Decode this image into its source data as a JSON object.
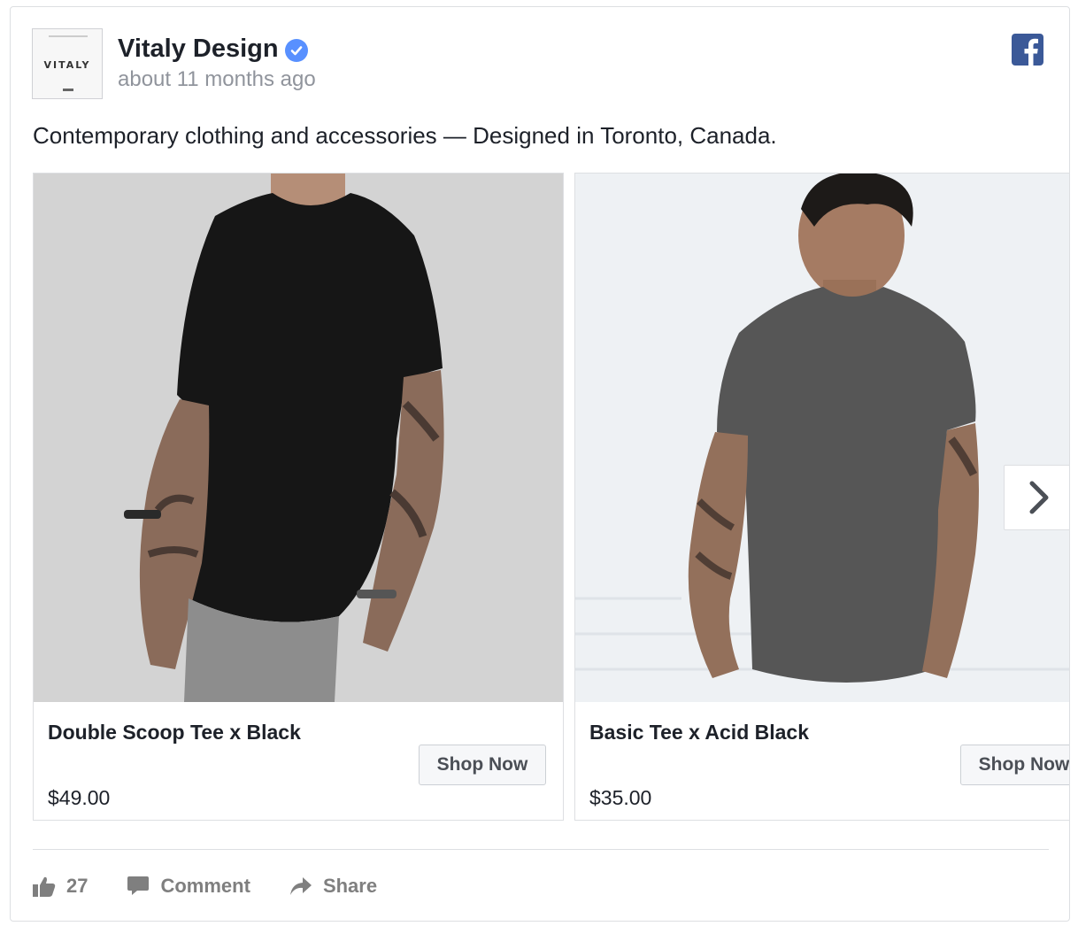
{
  "post": {
    "page_name": "Vitaly Design",
    "timestamp": "about 11 months ago",
    "avatar_logo": "VITALY",
    "message": "Contemporary clothing and accessories — Designed in Toronto, Canada."
  },
  "carousel": {
    "items": [
      {
        "title": "Double Scoop Tee x Black",
        "price": "$49.00",
        "cta": "Shop Now",
        "image": "man in black long tee against grey wall"
      },
      {
        "title": "Basic Tee x Acid Black",
        "price": "$35.00",
        "cta": "Shop Now",
        "image": "man in acid-wash grey tee against white brick wall"
      }
    ],
    "next_icon": "chevron-right-icon"
  },
  "actions": {
    "like_count": "27",
    "comment_label": "Comment",
    "share_label": "Share"
  },
  "colors": {
    "facebook_blue": "#3b5998",
    "verified_blue": "#5890ff",
    "muted_text": "#90949c"
  }
}
